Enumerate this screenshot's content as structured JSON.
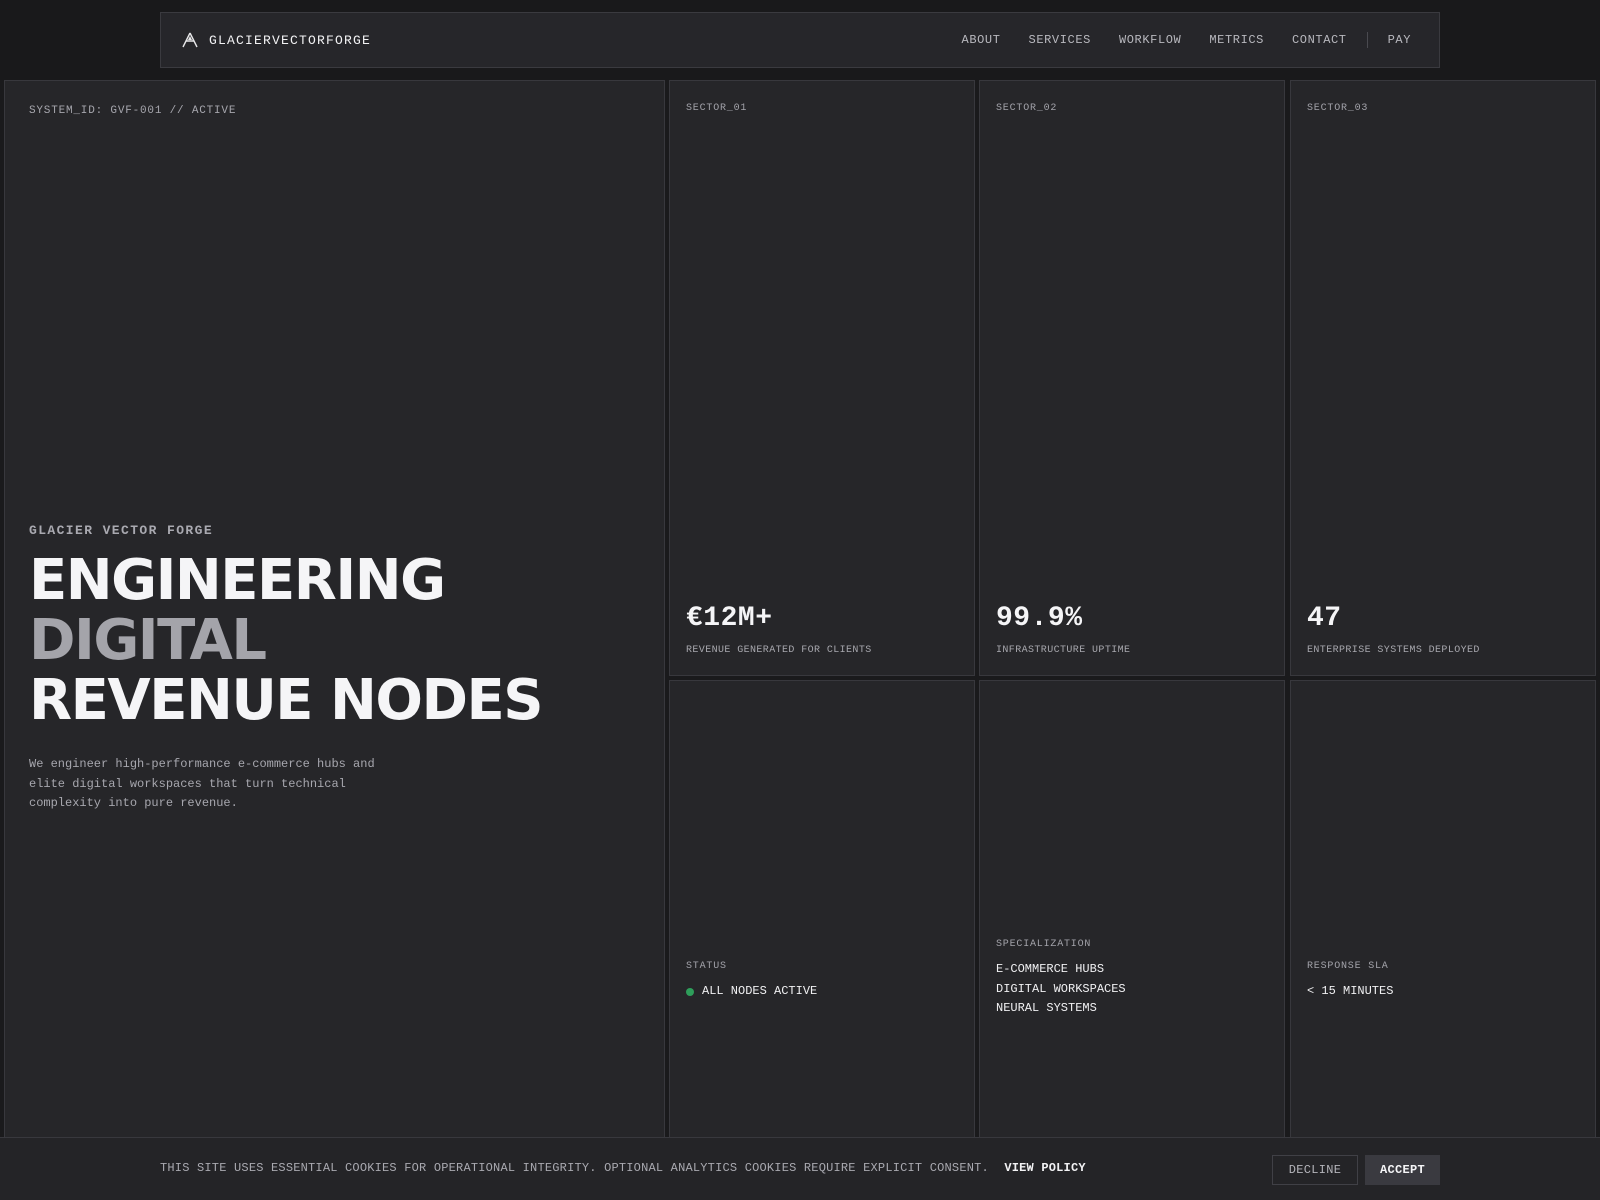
{
  "nav": {
    "brand": "GLACIERVECTORFORGE",
    "links": [
      "ABOUT",
      "SERVICES",
      "WORKFLOW",
      "METRICS",
      "CONTACT"
    ],
    "pay": "PAY"
  },
  "hero": {
    "system_id": "SYSTEM_ID: GVF-001 // ACTIVE",
    "eyebrow": "GLACIER VECTOR FORGE",
    "title_line1": "ENGINEERING",
    "title_line2": "DIGITAL",
    "title_line3": "REVENUE NODES",
    "description": "We engineer high-performance e-commerce hubs and elite digital workspaces that turn technical complexity into pure revenue."
  },
  "stats": [
    {
      "sector": "SECTOR_01",
      "value": "€12M+",
      "caption": "REVENUE GENERATED FOR CLIENTS"
    },
    {
      "sector": "SECTOR_02",
      "value": "99.9%",
      "caption": "INFRASTRUCTURE UPTIME"
    },
    {
      "sector": "SECTOR_03",
      "value": "47",
      "caption": "ENTERPRISE SYSTEMS DEPLOYED"
    }
  ],
  "info": {
    "status_label": "STATUS",
    "status_value": "ALL NODES ACTIVE",
    "status_color": "#2e9e5a",
    "specialization_label": "SPECIALIZATION",
    "specializations": [
      "E-COMMERCE HUBS",
      "DIGITAL WORKSPACES",
      "NEURAL SYSTEMS"
    ],
    "sla_label": "RESPONSE SLA",
    "sla_value": "< 15 MINUTES"
  },
  "cookie": {
    "text": "THIS SITE USES ESSENTIAL COOKIES FOR OPERATIONAL INTEGRITY. OPTIONAL ANALYTICS COOKIES REQUIRE EXPLICIT CONSENT.",
    "link": "VIEW POLICY",
    "decline": "DECLINE",
    "accept": "ACCEPT"
  }
}
